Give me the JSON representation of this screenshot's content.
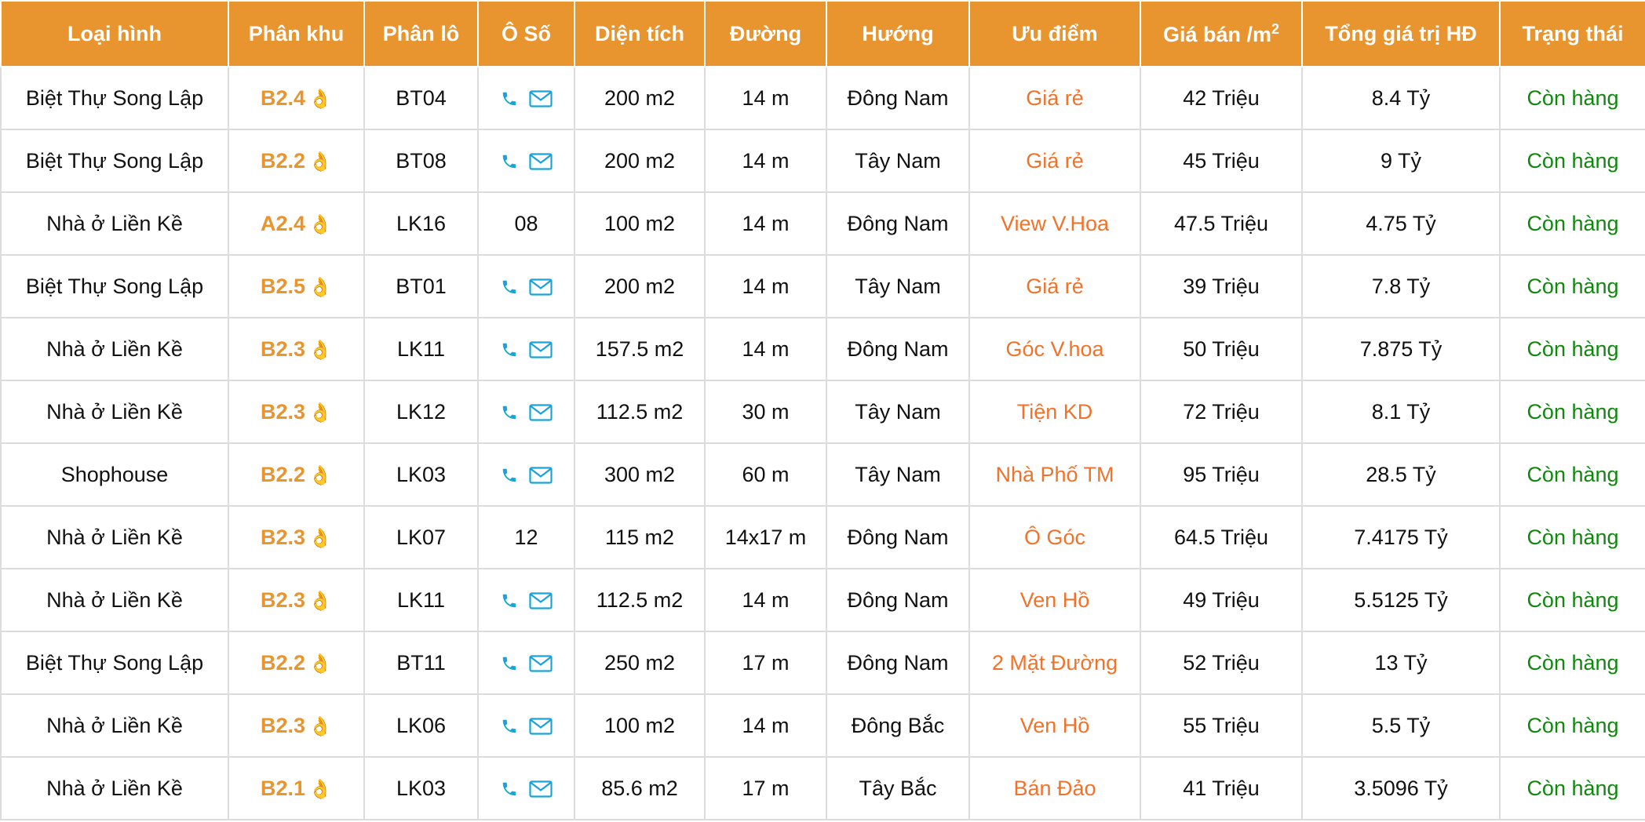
{
  "headers": [
    "Loại hình",
    "Phân khu",
    "Phân lô",
    "Ô Số",
    "Diện tích",
    "Đường",
    "Hướng",
    "Ưu điểm",
    "Giá bán /m",
    "Tổng giá trị HĐ",
    "Trạng thái"
  ],
  "header_sup": "2",
  "colors": {
    "header_bg": "#e9952f",
    "accent_orange": "#f0732b",
    "status_green": "#12870f",
    "icon_blue": "#1aa3d9"
  },
  "icons": [
    "hand-point-icon",
    "phone-icon",
    "envelope-icon"
  ],
  "rows": [
    {
      "loai": "Biệt Thự Song Lập",
      "phankhu": "B2.4",
      "phanlo": "BT04",
      "oso": "",
      "dientich": "200 m2",
      "duong": "14 m",
      "huong": "Đông Nam",
      "uudiem": "Giá rẻ",
      "gia": "42 Triệu",
      "tong": "8.4 Tỷ",
      "trangthai": "Còn hàng"
    },
    {
      "loai": "Biệt Thự Song Lập",
      "phankhu": "B2.2",
      "phanlo": "BT08",
      "oso": "",
      "dientich": "200 m2",
      "duong": "14 m",
      "huong": "Tây Nam",
      "uudiem": "Giá rẻ",
      "gia": "45 Triệu",
      "tong": "9 Tỷ",
      "trangthai": "Còn hàng"
    },
    {
      "loai": "Nhà ở Liền Kề",
      "phankhu": "A2.4",
      "phanlo": "LK16",
      "oso": "08",
      "dientich": "100 m2",
      "duong": "14 m",
      "huong": "Đông Nam",
      "uudiem": "View V.Hoa",
      "gia": "47.5 Triệu",
      "tong": "4.75 Tỷ",
      "trangthai": "Còn hàng"
    },
    {
      "loai": "Biệt Thự Song Lập",
      "phankhu": "B2.5",
      "phanlo": "BT01",
      "oso": "",
      "dientich": "200 m2",
      "duong": "14 m",
      "huong": "Tây Nam",
      "uudiem": "Giá rẻ",
      "gia": "39 Triệu",
      "tong": "7.8 Tỷ",
      "trangthai": "Còn hàng"
    },
    {
      "loai": "Nhà ở Liền Kề",
      "phankhu": "B2.3",
      "phanlo": "LK11",
      "oso": "",
      "dientich": "157.5 m2",
      "duong": "14 m",
      "huong": "Đông Nam",
      "uudiem": "Góc V.hoa",
      "gia": "50 Triệu",
      "tong": "7.875 Tỷ",
      "trangthai": "Còn hàng"
    },
    {
      "loai": "Nhà ở Liền Kề",
      "phankhu": "B2.3",
      "phanlo": "LK12",
      "oso": "",
      "dientich": "112.5 m2",
      "duong": "30 m",
      "huong": "Tây Nam",
      "uudiem": "Tiện KD",
      "gia": "72 Triệu",
      "tong": "8.1 Tỷ",
      "trangthai": "Còn hàng"
    },
    {
      "loai": "Shophouse",
      "phankhu": "B2.2",
      "phanlo": "LK03",
      "oso": "",
      "dientich": "300 m2",
      "duong": "60 m",
      "huong": "Tây Nam",
      "uudiem": "Nhà Phố TM",
      "gia": "95 Triệu",
      "tong": "28.5 Tỷ",
      "trangthai": "Còn hàng"
    },
    {
      "loai": "Nhà ở Liền Kề",
      "phankhu": "B2.3",
      "phanlo": "LK07",
      "oso": "12",
      "dientich": "115 m2",
      "duong": "14x17 m",
      "huong": "Đông Nam",
      "uudiem": "Ô Góc",
      "gia": "64.5 Triệu",
      "tong": "7.4175 Tỷ",
      "trangthai": "Còn hàng"
    },
    {
      "loai": "Nhà ở Liền Kề",
      "phankhu": "B2.3",
      "phanlo": "LK11",
      "oso": "",
      "dientich": "112.5 m2",
      "duong": "14 m",
      "huong": "Đông Nam",
      "uudiem": "Ven Hồ",
      "gia": "49 Triệu",
      "tong": "5.5125 Tỷ",
      "trangthai": "Còn hàng"
    },
    {
      "loai": "Biệt Thự Song Lập",
      "phankhu": "B2.2",
      "phanlo": "BT11",
      "oso": "",
      "dientich": "250 m2",
      "duong": "17 m",
      "huong": "Đông Nam",
      "uudiem": "2 Mặt Đường",
      "gia": "52 Triệu",
      "tong": "13 Tỷ",
      "trangthai": "Còn hàng"
    },
    {
      "loai": "Nhà ở Liền Kề",
      "phankhu": "B2.3",
      "phanlo": "LK06",
      "oso": "",
      "dientich": "100 m2",
      "duong": "14 m",
      "huong": "Đông Bắc",
      "uudiem": "Ven Hồ",
      "gia": "55 Triệu",
      "tong": "5.5 Tỷ",
      "trangthai": "Còn hàng"
    },
    {
      "loai": "Nhà ở Liền Kề",
      "phankhu": "B2.1",
      "phanlo": "LK03",
      "oso": "",
      "dientich": "85.6 m2",
      "duong": "17 m",
      "huong": "Tây Bắc",
      "uudiem": "Bán Đảo",
      "gia": "41 Triệu",
      "tong": "3.5096 Tỷ",
      "trangthai": "Còn hàng"
    }
  ]
}
